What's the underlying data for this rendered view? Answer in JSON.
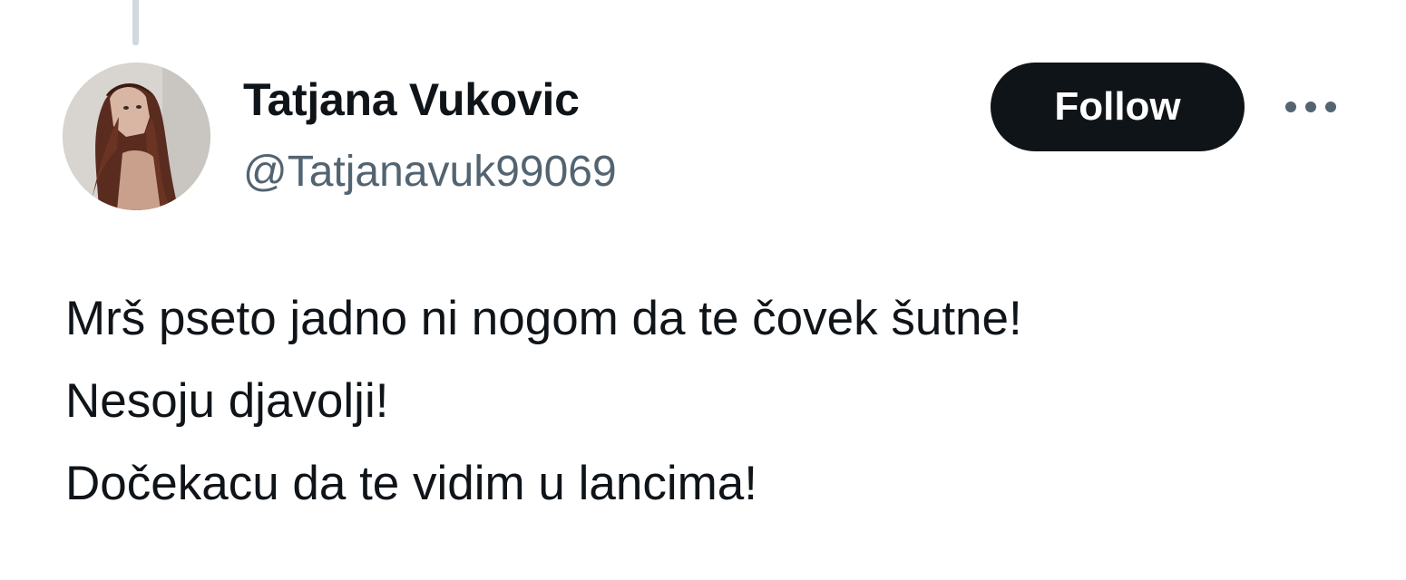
{
  "author": {
    "display_name": "Tatjana Vukovic",
    "handle": "@Tatjanavuk99069",
    "avatar_icon": "profile-photo"
  },
  "actions": {
    "follow_label": "Follow",
    "more_icon": "more-horizontal-icon"
  },
  "tweet": {
    "lines": [
      "Mrš pseto jadno ni nogom da te čovek šutne!",
      "Nesoju djavolji!",
      "Dočekacu da te vidim u lancima!"
    ]
  },
  "colors": {
    "text_primary": "#0f1419",
    "text_secondary": "#536471",
    "button_bg": "#0f1419",
    "button_text": "#ffffff",
    "thread_line": "#cfd9de"
  }
}
